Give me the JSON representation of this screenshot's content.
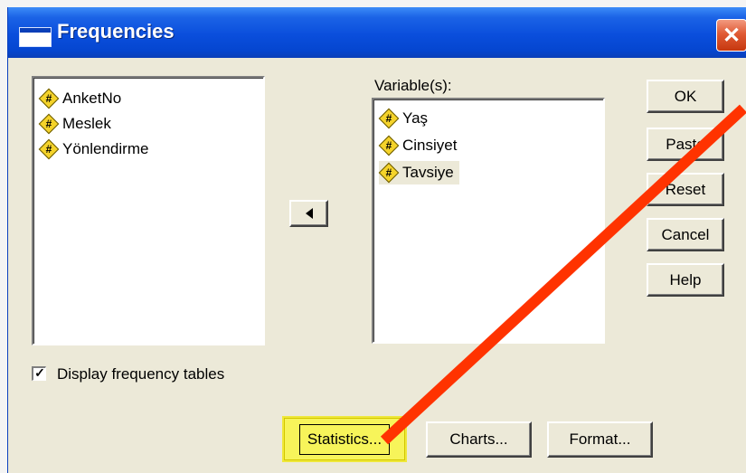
{
  "window": {
    "title": "Frequencies"
  },
  "source_list": {
    "items": [
      {
        "label": "AnketNo",
        "icon": "numeric-variable-icon"
      },
      {
        "label": "Meslek",
        "icon": "numeric-variable-icon"
      },
      {
        "label": "Yönlendirme",
        "icon": "numeric-variable-icon"
      }
    ]
  },
  "variables": {
    "label": "Variable(s):",
    "items": [
      {
        "label": "Yaş",
        "icon": "numeric-variable-icon",
        "selected": false
      },
      {
        "label": "Cinsiyet",
        "icon": "numeric-variable-icon",
        "selected": false
      },
      {
        "label": "Tavsiye",
        "icon": "numeric-variable-icon",
        "selected": true
      }
    ]
  },
  "icons": {
    "variable_glyph": "#",
    "close_glyph": "✕",
    "check_glyph": "✓"
  },
  "buttons": {
    "ok": "OK",
    "paste": "Paste",
    "reset": "Reset",
    "cancel": "Cancel",
    "help": "Help",
    "statistics": "Statistics...",
    "charts": "Charts...",
    "format": "Format..."
  },
  "options": {
    "display_frequency_tables": {
      "label": "Display frequency tables",
      "checked": true
    }
  },
  "colors": {
    "titlebar": "#0a4edc",
    "dialog_bg": "#ece9d8",
    "highlight": "#f7f45a",
    "annotation_arrow": "#ff3300"
  }
}
